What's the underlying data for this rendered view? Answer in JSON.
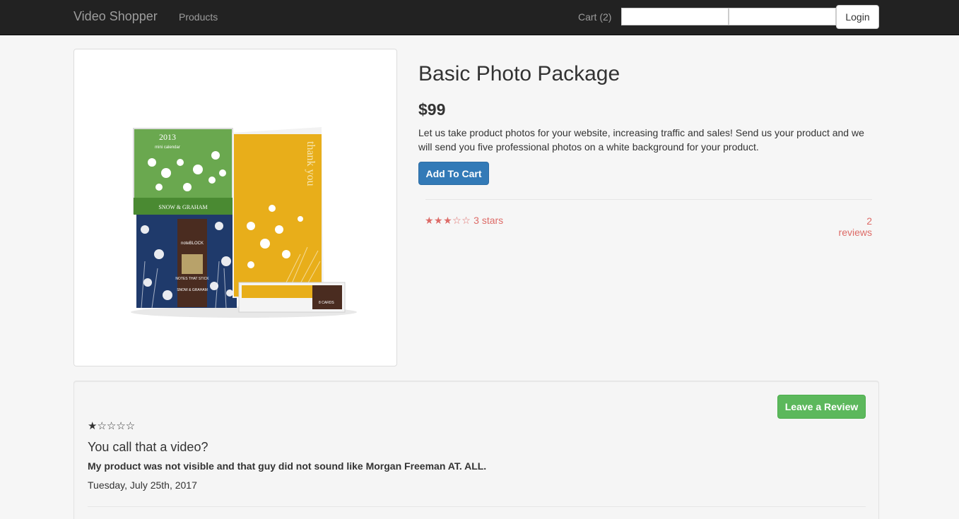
{
  "navbar": {
    "brand": "Video Shopper",
    "products_link": "Products",
    "cart_link": "Cart (2)",
    "input1_value": "",
    "input2_value": "",
    "login_label": "Login"
  },
  "product": {
    "title": "Basic Photo Package",
    "price": "$99",
    "description": "Let us take product photos for your website, increasing traffic and sales! Send us your product and we will send you five professional photos on a white background for your product.",
    "add_to_cart_label": "Add To Cart",
    "rating_stars": "★★★☆☆",
    "rating_value": 3,
    "rating_label": "3 stars",
    "reviews_count": "2 reviews",
    "image": {
      "calendar_year": "2013",
      "calendar_word": "mini calendar",
      "calendar_brand": "SNOW & GRAHAM",
      "card_text": "thank you",
      "box_brand_top": "noteBLOCK",
      "box_label": "NOTES THAT STICK",
      "box_brand": "SNOW & GRAHAM",
      "cards_label": "8 CARDS"
    }
  },
  "reviews": {
    "leave_review_label": "Leave a Review",
    "items": [
      {
        "stars": "★☆☆☆☆",
        "rating": 1,
        "title": "You call that a video?",
        "body": "My product was not visible and that guy did not sound like Morgan Freeman AT. ALL.",
        "date": "Tuesday, July 25th, 2017"
      }
    ]
  },
  "colors": {
    "navbar_bg": "#222222",
    "primary": "#337ab7",
    "success": "#5cb85c",
    "rating": "#d9534f",
    "calendar_green": "#6aa84f",
    "card_yellow": "#e8ae1a",
    "box_navy": "#1f3a6b",
    "band_brown": "#4a2c20"
  }
}
